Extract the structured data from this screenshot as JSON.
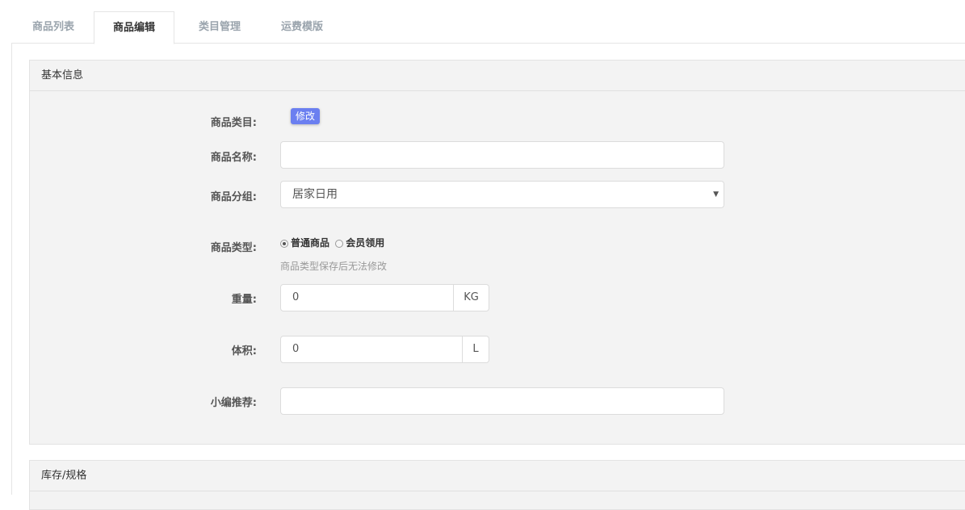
{
  "tabs": [
    {
      "label": "商品列表",
      "active": false
    },
    {
      "label": "商品编辑",
      "active": true
    },
    {
      "label": "类目管理",
      "active": false
    },
    {
      "label": "运费模版",
      "active": false
    }
  ],
  "basic": {
    "title": "基本信息",
    "category_label": "商品类目:",
    "category_edit": "修改",
    "name_label": "商品名称:",
    "name_value": "",
    "group_label": "商品分组:",
    "group_value": "居家日用",
    "type_label": "商品类型:",
    "type_options": [
      {
        "label": "普通商品",
        "checked": true
      },
      {
        "label": "会员领用",
        "checked": false
      }
    ],
    "type_help": "商品类型保存后无法修改",
    "weight_label": "重量:",
    "weight_value": "0",
    "weight_unit": "KG",
    "volume_label": "体积:",
    "volume_value": "0",
    "volume_unit": "L",
    "recommend_label": "小编推荐:",
    "recommend_value": ""
  },
  "stock": {
    "title": "库存/规格"
  },
  "colors": {
    "accent": "#6b7ff0",
    "panel_bg": "#f3f3f3"
  }
}
